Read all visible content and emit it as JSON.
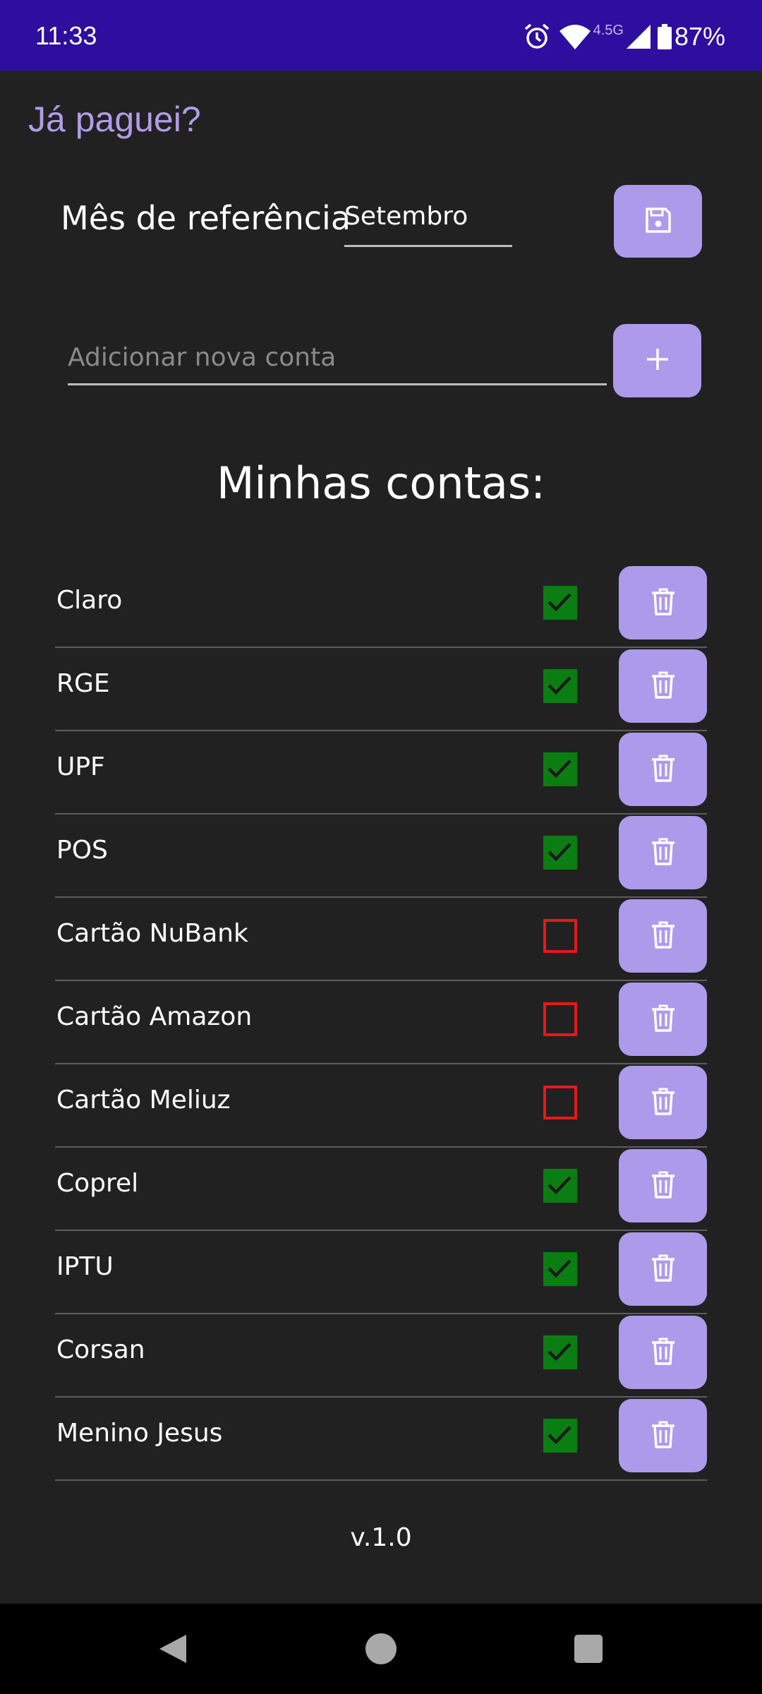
{
  "status_bar": {
    "time": "11:33",
    "network": "4.5G",
    "battery": "87%",
    "icons": [
      "alarm-icon",
      "wifi-icon",
      "signal-icon",
      "battery-icon"
    ]
  },
  "app": {
    "title": "Já paguei?"
  },
  "month": {
    "label": "Mês de referência",
    "value": "Setembro",
    "save_icon": "save-icon"
  },
  "new_account": {
    "placeholder": "Adicionar nova conta",
    "add_label": "+"
  },
  "list": {
    "heading": "Minhas contas:",
    "items": [
      {
        "name": "Claro",
        "paid": true
      },
      {
        "name": "RGE",
        "paid": true
      },
      {
        "name": "UPF",
        "paid": true
      },
      {
        "name": "POS",
        "paid": true
      },
      {
        "name": "Cartão NuBank",
        "paid": false
      },
      {
        "name": "Cartão Amazon",
        "paid": false
      },
      {
        "name": "Cartão Meliuz",
        "paid": false
      },
      {
        "name": "Coprel",
        "paid": true
      },
      {
        "name": "IPTU",
        "paid": true
      },
      {
        "name": "Corsan",
        "paid": true
      },
      {
        "name": "Menino Jesus",
        "paid": true
      }
    ],
    "delete_icon": "trash-icon"
  },
  "footer": {
    "version": "v.1.0"
  },
  "colors": {
    "status_bar": "#2e0e9e",
    "background": "#212121",
    "accent": "#ae9aeb",
    "title": "#b19ce8",
    "paid": "#0a7d13",
    "unpaid": "#e81818"
  }
}
